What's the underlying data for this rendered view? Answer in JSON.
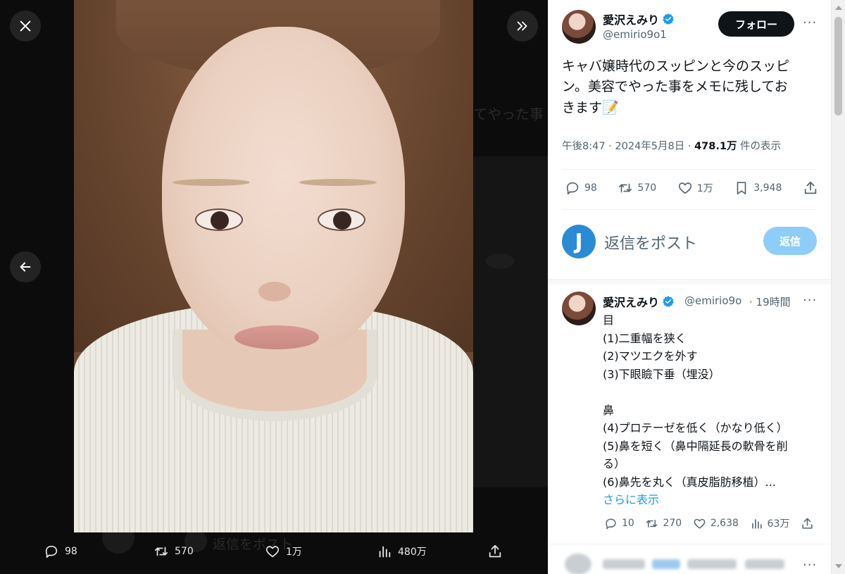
{
  "viewer": {
    "ghost_text": "てやった事",
    "ghost_reply": "返信をポスト",
    "actions": {
      "replies": "98",
      "reposts": "570",
      "likes": "1万",
      "views": "480万"
    }
  },
  "tweet": {
    "author_name": "愛沢えみり",
    "handle": "@emirio9o1",
    "follow_label": "フォロー",
    "more": "···",
    "text_line1": "キャバ嬢時代のスッピンと今のスッピ",
    "text_line2": "ン。美容でやった事をメモに残してお",
    "text_line3": "きます📝",
    "time": "午後8:47 · 2024年5月8日 · ",
    "views_count": "478.1万",
    "views_label": " 件の表示",
    "actions": {
      "replies": "98",
      "reposts": "570",
      "likes": "1万",
      "bookmarks": "3,948"
    }
  },
  "composer": {
    "avatar_letter": "J",
    "placeholder": "返信をポスト",
    "reply_button": "返信"
  },
  "reply": {
    "author_name": "愛沢えみり",
    "handle": "@emirio9o",
    "time": "· 19時間",
    "more": "···",
    "lines": [
      "目",
      "(1)二重幅を狭く",
      "(2)マツエクを外す",
      "(3)下眼瞼下垂（埋没）",
      "",
      "鼻",
      "(4)プロテーゼを低く（かなり低く）",
      "(5)鼻を短く（鼻中隔延長の軟骨を削",
      "る）",
      "(6)鼻先を丸く（真皮脂肪移植）..."
    ],
    "show_more": "さらに表示",
    "actions": {
      "replies": "10",
      "reposts": "270",
      "likes": "2,638",
      "views": "63万"
    }
  },
  "colors": {
    "accent": "#1d9bf0",
    "text": "#0f1419",
    "muted": "#536471",
    "reply_button": "#8ecdf8"
  },
  "icons": [
    "close-icon",
    "double-chevron-icon",
    "back-arrow-icon",
    "reply-icon",
    "repost-icon",
    "like-icon",
    "views-icon",
    "share-icon",
    "bookmark-icon",
    "verified-icon",
    "more-icon"
  ]
}
